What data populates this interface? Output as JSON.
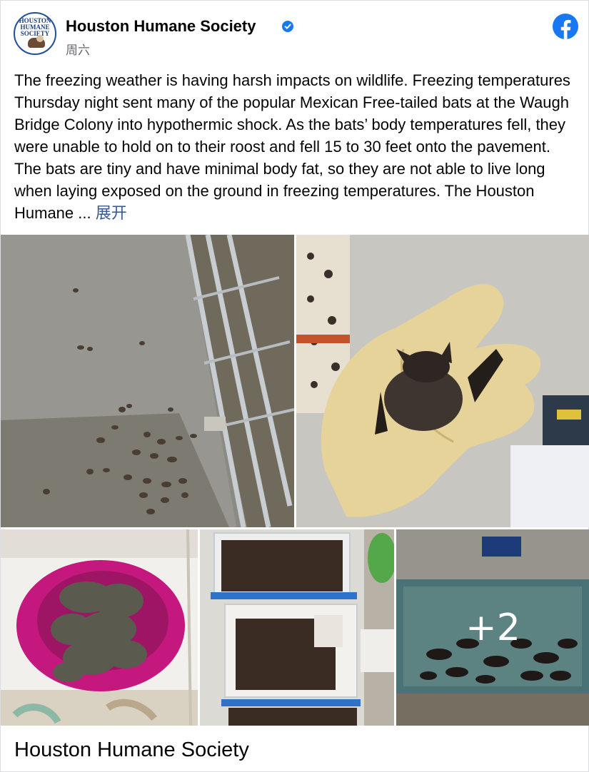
{
  "post": {
    "page_name": "Houston Humane Society",
    "avatar_text": "HOUSTON HUMANE SOCIETY",
    "timestamp": "周六",
    "body": "The freezing weather is having harsh impacts on wildlife. Freezing temperatures Thursday night sent many of the popular Mexican Free-tailed bats at the Waugh Bridge Colony into hypothermic shock. As the bats’  body temperatures fell, they were unable to hold on to their roost and fell 15 to 30 feet onto the pavement. The bats are tiny and have minimal body fat, so they are not able to live long when laying exposed on the ground in freezing temperatures. The Houston Humane ...",
    "see_more": "展开",
    "more_photos": "+2",
    "link_title": "Houston Humane Society"
  },
  "icons": {
    "verified": "verified-badge-icon",
    "facebook": "facebook-logo-icon"
  },
  "colors": {
    "brand": "#1877f2",
    "link": "#385898",
    "text": "#050505",
    "secondary_text": "#65676b"
  }
}
